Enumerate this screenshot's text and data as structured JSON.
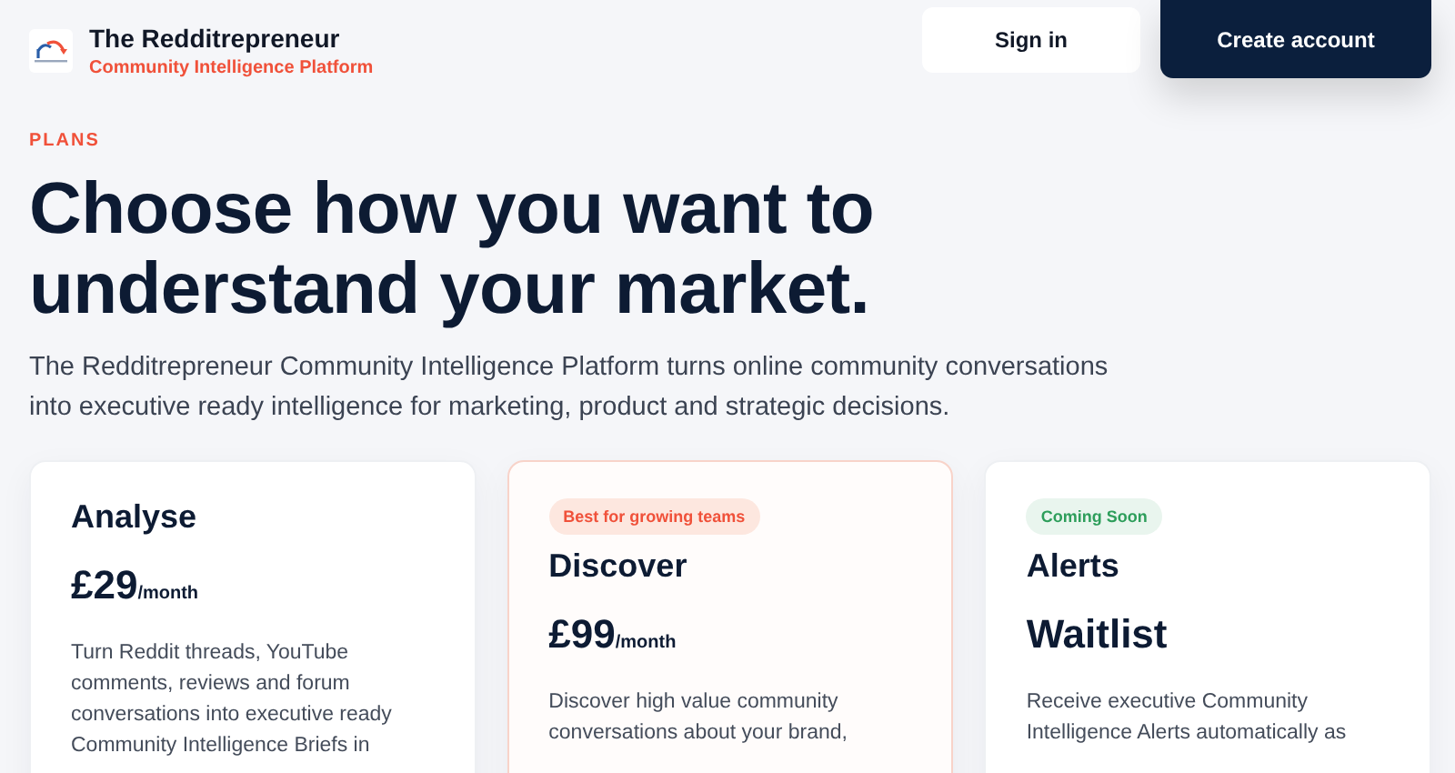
{
  "brand": {
    "name": "The Redditrepreneur",
    "tagline": "Community Intelligence Platform"
  },
  "nav": {
    "buttons": [
      {
        "label": "Sign in",
        "kind": "secondary"
      },
      {
        "label": "Create account",
        "kind": "primary"
      }
    ]
  },
  "hero": {
    "eyebrow": "PLANS",
    "title_lines": [
      "Choose how you want to",
      "understand your market."
    ],
    "intro": "The Redditrepreneur Community Intelligence Platform turns online community conversations into executive ready intelligence for marketing, product and strategic decisions."
  },
  "plans": [
    {
      "name": "Analyse",
      "price": "£29",
      "period": "/month",
      "description": "Turn Reddit threads, YouTube comments, reviews and forum conversations into executive ready Community Intelligence Briefs in",
      "highlighted": false
    },
    {
      "name": "Discover",
      "badge": {
        "text": "Best for growing teams",
        "kind": "accent"
      },
      "price": "£99",
      "period": "/month",
      "description": "Discover high value community conversations about your brand,",
      "highlighted": true
    },
    {
      "name": "Alerts",
      "badge": {
        "text": "Coming Soon",
        "kind": "success"
      },
      "price": "Waitlist",
      "description": "Receive executive Community Intelligence Alerts automatically as",
      "highlighted": false
    }
  ]
}
